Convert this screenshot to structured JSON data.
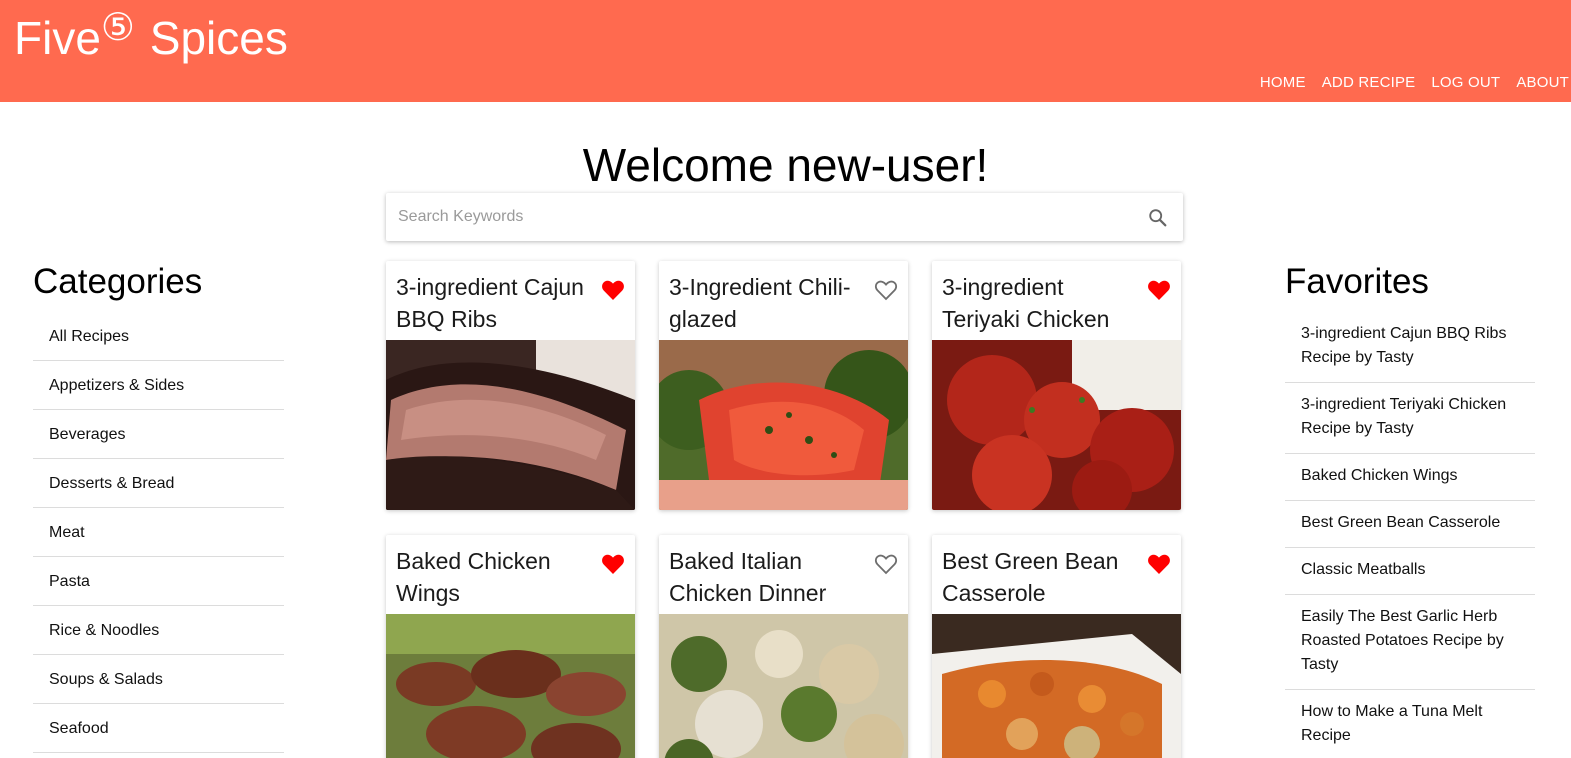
{
  "header": {
    "brand_left": "Five",
    "brand_mark": "⑤",
    "brand_right": "Spices",
    "nav": [
      "HOME",
      "ADD RECIPE",
      "LOG OUT",
      "ABOUT"
    ],
    "background_color": "#ff6a4f"
  },
  "welcome": "Welcome new-user!",
  "search": {
    "placeholder": "Search Keywords",
    "value": "",
    "icon": "search-icon"
  },
  "categories": {
    "title": "Categories",
    "items": [
      "All Recipes",
      "Appetizers & Sides",
      "Beverages",
      "Desserts & Bread",
      "Meat",
      "Pasta",
      "Rice & Noodles",
      "Soups & Salads",
      "Seafood"
    ]
  },
  "favorites": {
    "title": "Favorites",
    "items": [
      "3-ingredient Cajun BBQ Ribs Recipe by Tasty",
      "3-ingredient Teriyaki Chicken Recipe by Tasty",
      "Baked Chicken Wings",
      "Best Green Bean Casserole",
      "Classic Meatballs",
      "Easily The Best Garlic Herb Roasted Potatoes Recipe by Tasty",
      "How to Make a Tuna Melt Recipe"
    ]
  },
  "recipes": [
    {
      "title": "3-ingredient Cajun BBQ Ribs",
      "favorited": true,
      "image": "ribs-photo"
    },
    {
      "title": "3-Ingredient Chili-glazed",
      "favorited": false,
      "image": "chili-glazed-photo"
    },
    {
      "title": "3-ingredient Teriyaki Chicken",
      "favorited": true,
      "image": "teriyaki-chicken-photo"
    },
    {
      "title": "Baked Chicken Wings",
      "favorited": true,
      "image": "chicken-wings-photo"
    },
    {
      "title": "Baked Italian Chicken Dinner",
      "favorited": false,
      "image": "italian-chicken-photo"
    },
    {
      "title": "Best Green Bean Casserole",
      "favorited": true,
      "image": "casserole-photo"
    }
  ],
  "colors": {
    "heart_filled": "#ff0000",
    "heart_outline": "#6e6e6e",
    "divider": "#dcdcdc"
  }
}
